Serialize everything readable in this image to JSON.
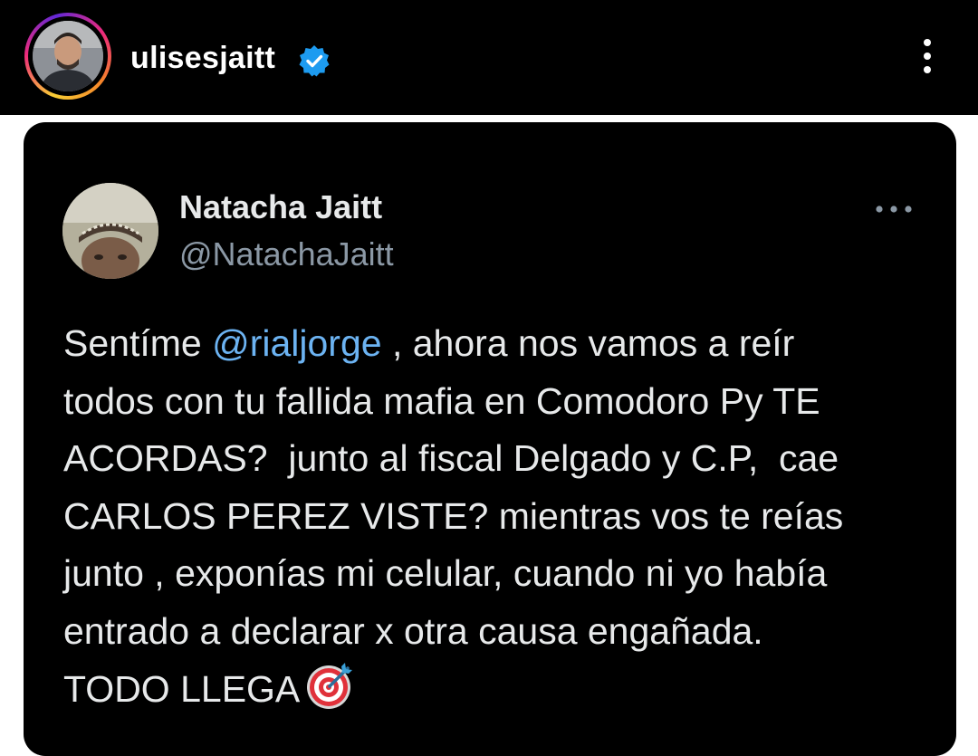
{
  "header": {
    "username": "ulisesjaitt",
    "verified_icon": "verified-badge-icon",
    "menu_icon": "more-vertical-icon",
    "colors": {
      "background": "#000000",
      "verified": "#1d9bf0"
    }
  },
  "tweet": {
    "display_name": "Natacha Jaitt",
    "handle": "@NatachaJaitt",
    "menu_icon": "more-horizontal-icon",
    "text_before_mention": "Sentíme ",
    "mention": "@rialjorge",
    "text_after_mention": " , ahora nos vamos a reír\ntodos con tu fallida mafia en Comodoro Py TE\nACORDAS?  junto al fiscal Delgado y C.P,  cae\nCARLOS PEREZ VISTE? mientras vos te reías\njunto , exponías mi celular, cuando ni yo había\nentrado a declarar x otra causa engañada.\nTODO LLEGA",
    "emoji_icon": "direct-hit-target-icon",
    "colors": {
      "text": "#e7e9ea",
      "mention": "#6cb3f2",
      "handle": "#8b98a5"
    }
  }
}
